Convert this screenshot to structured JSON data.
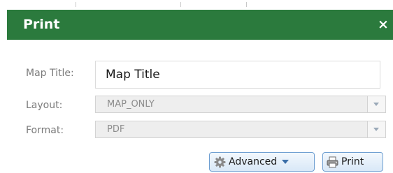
{
  "dialog": {
    "title": "Print",
    "close_glyph": "×"
  },
  "form": {
    "map_title": {
      "label": "Map Title:",
      "value": "Map Title"
    },
    "layout": {
      "label": "Layout:",
      "value": "MAP_ONLY"
    },
    "format": {
      "label": "Format:",
      "value": "PDF"
    }
  },
  "buttons": {
    "advanced": {
      "label": "Advanced",
      "icon": "gear-icon"
    },
    "print": {
      "label": "Print",
      "icon": "printer-icon"
    }
  },
  "colors": {
    "header_bg": "#2b7a3d",
    "button_border": "#6d9ed1"
  }
}
